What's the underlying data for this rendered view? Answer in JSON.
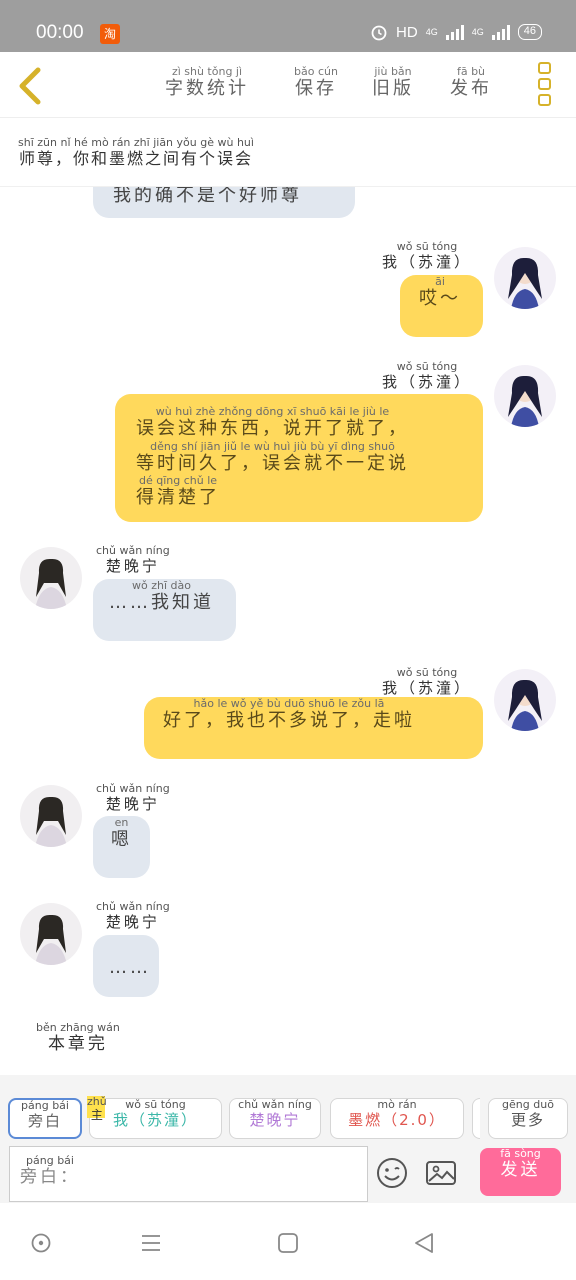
{
  "status_bar": {
    "time": "00:00",
    "taobao": "淘",
    "hd": "HD",
    "net1": "4G",
    "net2": "4G",
    "battery": "46"
  },
  "header": {
    "menu": [
      {
        "label": "字数统计",
        "pinyin": "zì shù tǒng jì"
      },
      {
        "label": "保存",
        "pinyin": "bǎo cún"
      },
      {
        "label": "旧版",
        "pinyin": "jiù bǎn"
      },
      {
        "label": "发布",
        "pinyin": "fā bù"
      }
    ]
  },
  "notice": {
    "text": "师尊，你和墨燃之间有个误会",
    "pinyin": "shī zūn   nǐ hé mò rán zhī jiān yǒu gè wù huì"
  },
  "messages": {
    "m0": {
      "text": "我的确不是个好师尊"
    },
    "m1": {
      "speaker": "我（苏潼）",
      "speaker_pinyin": "wǒ   sū tóng",
      "text": "哎～",
      "pinyin": "āi"
    },
    "m2": {
      "speaker": "我（苏潼）",
      "speaker_pinyin": "wǒ   sū tóng",
      "line1": "误会这种东西，说开了就了，",
      "line1_pinyin": "wù huì zhè zhǒng dōng xī   shuō kāi le jiù le",
      "line2": "等时间久了，误会就不一定说",
      "line2_pinyin": "děng shí jiān jiǔ le   wù huì jiù bù yī dìng shuō",
      "line3": "得清楚了",
      "line3_pinyin": "dé qīng chǔ le"
    },
    "m3": {
      "speaker": "楚晚宁",
      "speaker_pinyin": "chǔ wǎn níng",
      "text": "……我知道",
      "pinyin": "wǒ zhī dào"
    },
    "m4": {
      "speaker": "我（苏潼）",
      "speaker_pinyin": "wǒ   sū tóng",
      "text": "好了，我也不多说了，走啦",
      "pinyin": "hǎo le   wǒ yě bù duō shuō le   zǒu lā"
    },
    "m5": {
      "speaker": "楚晚宁",
      "speaker_pinyin": "chǔ wǎn níng",
      "text": "嗯",
      "pinyin": "en"
    },
    "m6": {
      "speaker": "楚晚宁",
      "speaker_pinyin": "chǔ wǎn níng",
      "text": "……"
    }
  },
  "end_text": {
    "text": "本章完",
    "pinyin": "běn zhāng wán"
  },
  "roles": [
    {
      "label": "旁白",
      "pinyin": "páng bái",
      "color": "#666666"
    },
    {
      "label": "我（苏潼）",
      "pinyin": "wǒ   sū tóng",
      "color": "#3bb7a8",
      "badge": "主",
      "badge_pinyin": "zhǔ"
    },
    {
      "label": "楚晚宁",
      "pinyin": "chǔ wǎn níng",
      "color": "#b17ad6"
    },
    {
      "label": "墨燃（2.0）",
      "pinyin": "mò rán",
      "color": "#e0564f"
    },
    {
      "label": "更多",
      "pinyin": "gēng duō",
      "color": "#555555"
    }
  ],
  "input": {
    "placeholder": "旁白：",
    "placeholder_pinyin": "páng bái"
  },
  "send": {
    "label": "发送",
    "pinyin": "fā sòng",
    "color": "#ff6b9a"
  },
  "icons": {
    "back": "chevron-left-icon",
    "more": "more-vertical-icon",
    "emoji": "emoji-icon",
    "image": "image-icon",
    "nav_home": "circle-home-icon",
    "nav_menu": "menu-icon",
    "nav_recent": "square-icon",
    "nav_back": "triangle-back-icon"
  },
  "colors": {
    "accent": "#d6b22a",
    "bubble_me": "#ffd95c",
    "bubble_other": "#e1e7ef"
  }
}
